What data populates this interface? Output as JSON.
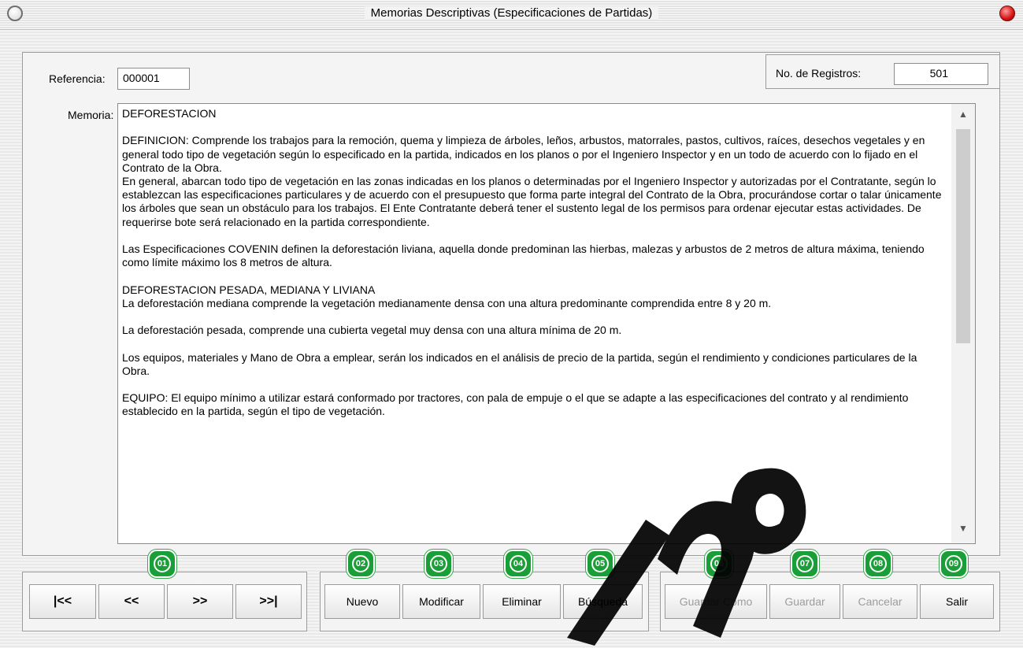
{
  "window": {
    "title": "Memorias Descriptivas (Especificaciones de Partidas)"
  },
  "form": {
    "referencia_label": "Referencia:",
    "referencia_value": "000001",
    "registros_label": "No. de Registros:",
    "registros_value": "501",
    "memoria_label": "Memoria:",
    "memoria_text": "DEFORESTACION\n\nDEFINICION: Comprende los trabajos para la remoción, quema y limpieza de árboles, leños, arbustos, matorrales, pastos, cultivos, raíces, desechos vegetales y en general todo tipo de vegetación según lo especificado en la partida, indicados en los planos o por el Ingeniero Inspector y en un todo de acuerdo con lo fijado en el Contrato de la Obra.\nEn general, abarcan todo tipo de vegetación en las zonas indicadas en los planos o determinadas por el Ingeniero Inspector y autorizadas por el Contratante, según lo establezcan las especificaciones particulares y de acuerdo con el presupuesto que forma parte integral del Contrato de la Obra, procurándose cortar o talar únicamente los árboles que sean un obstáculo para los trabajos. El Ente Contratante deberá tener el sustento legal de los permisos para ordenar ejecutar estas actividades. De requerirse bote será relacionado en la partida correspondiente.\n\nLas Especificaciones COVENIN definen la deforestación liviana, aquella donde predominan las hierbas, malezas y arbustos de 2 metros de altura máxima, teniendo como límite máximo los 8 metros de altura.\n\nDEFORESTACION PESADA, MEDIANA Y LIVIANA\nLa deforestación mediana comprende la vegetación medianamente densa con una altura predominante comprendida entre 8 y 20 m.\n\nLa deforestación pesada, comprende una cubierta vegetal muy densa con una altura mínima de 20 m.\n\nLos equipos, materiales y Mano de Obra a emplear, serán los indicados en el análisis de precio de la partida, según el rendimiento y condiciones particulares de la Obra.\n\nEQUIPO: El equipo mínimo a utilizar estará conformado por tractores, con pala de empuje o el que se adapte a las especificaciones del contrato y al rendimiento establecido en la partida, según el tipo de vegetación."
  },
  "navigation": {
    "first": "|<<",
    "prev": "<<",
    "next": ">>",
    "last": ">>|"
  },
  "actions": {
    "nuevo": "Nuevo",
    "modificar": "Modificar",
    "eliminar": "Eliminar",
    "busqueda": "Búsqueda",
    "guardar_como": "Guardar Como",
    "guardar": "Guardar",
    "cancelar": "Cancelar",
    "salir": "Salir"
  },
  "badges": [
    "01",
    "02",
    "03",
    "04",
    "05",
    "06",
    "07",
    "08",
    "09"
  ],
  "colors": {
    "badge_green": "#1a9e37",
    "close_red": "#d41414",
    "disabled_text": "#9d9d9d"
  }
}
